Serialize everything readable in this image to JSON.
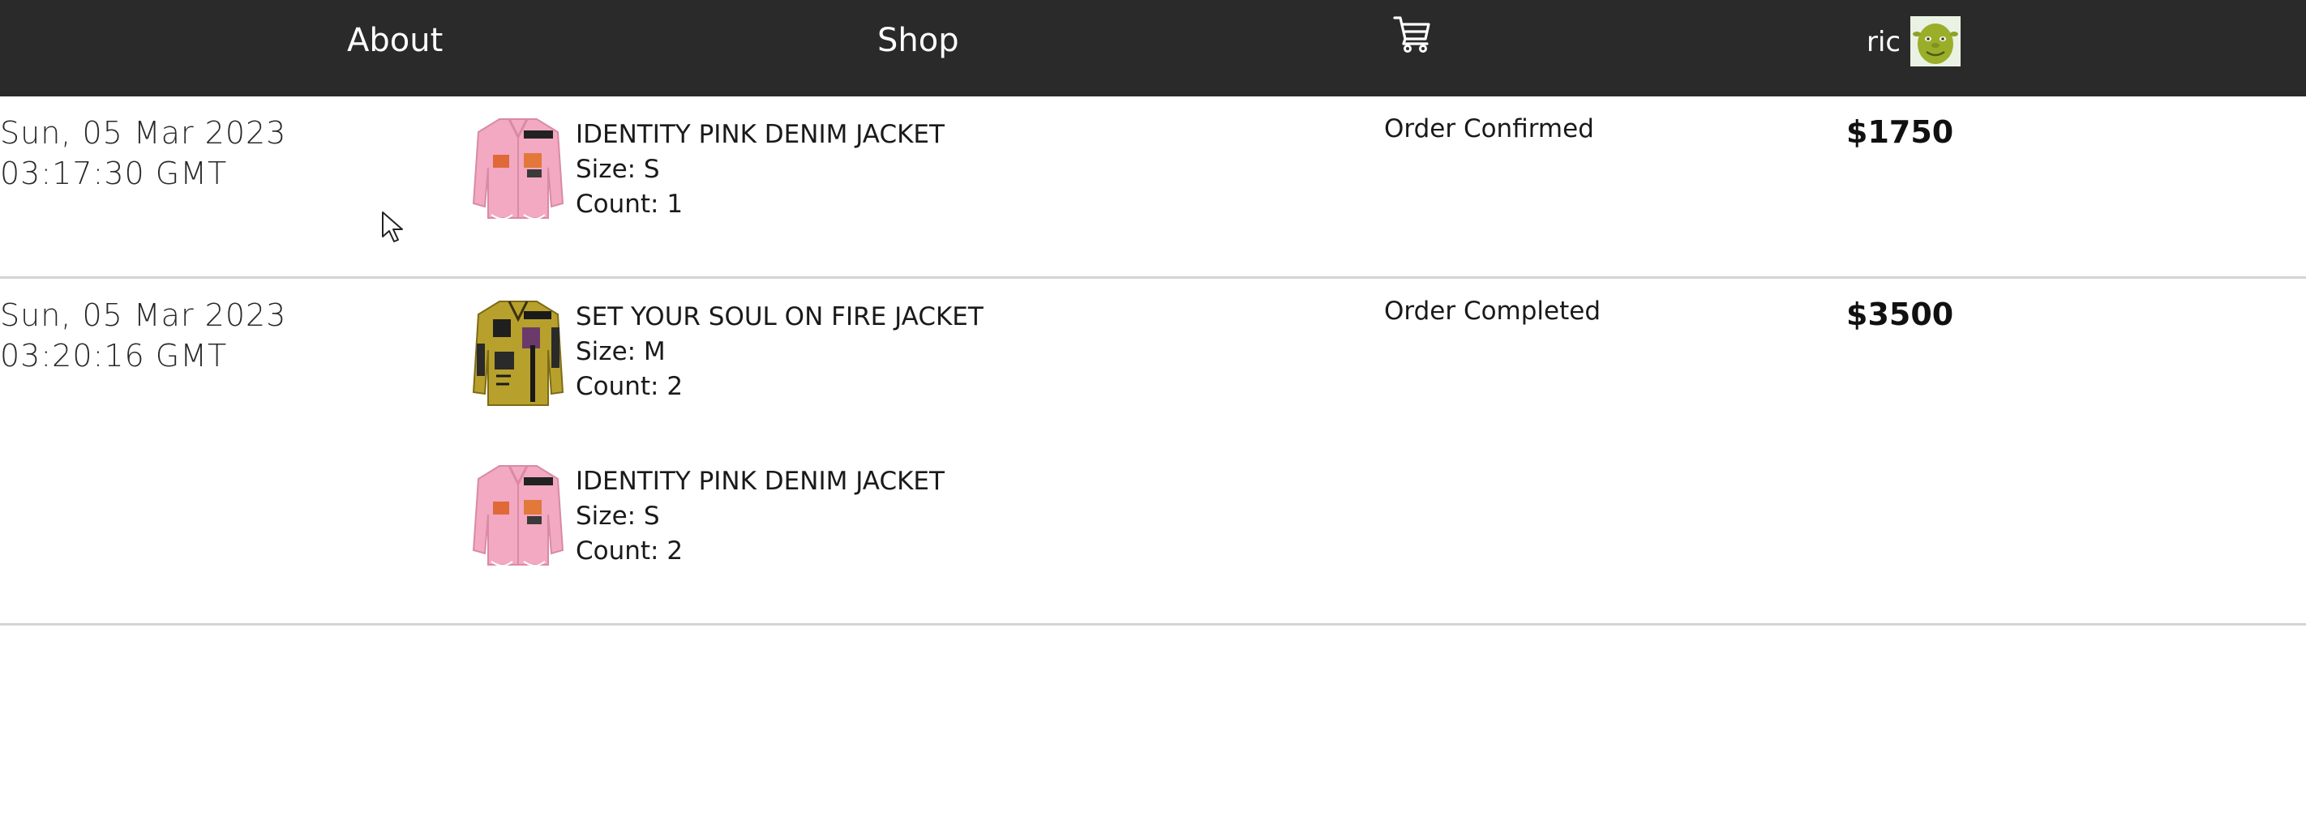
{
  "nav": {
    "about_label": "About",
    "shop_label": "Shop",
    "cart_icon": "shopping-cart-icon",
    "user_name": "ric",
    "avatar_icon": "user-avatar-ogre",
    "bar_color": "#2a2a2a"
  },
  "orders": [
    {
      "date": "Sun, 05 Mar 2023 03:17:30 GMT",
      "status": "Order Confirmed",
      "total": "$1750",
      "items": [
        {
          "name": "IDENTITY PINK DENIM JACKET",
          "size": "Size: S",
          "count": "Count: 1",
          "color": "#f0a6bf"
        }
      ]
    },
    {
      "date": "Sun, 05 Mar 2023 03:20:16 GMT",
      "status": "Order Completed",
      "total": "$3500",
      "items": [
        {
          "name": "SET YOUR SOUL ON FIRE JACKET",
          "size": "Size: M",
          "count": "Count: 2",
          "color": "#b59b2a"
        },
        {
          "name": "IDENTITY PINK DENIM JACKET",
          "size": "Size: S",
          "count": "Count: 2",
          "color": "#f0a6bf"
        }
      ]
    }
  ]
}
